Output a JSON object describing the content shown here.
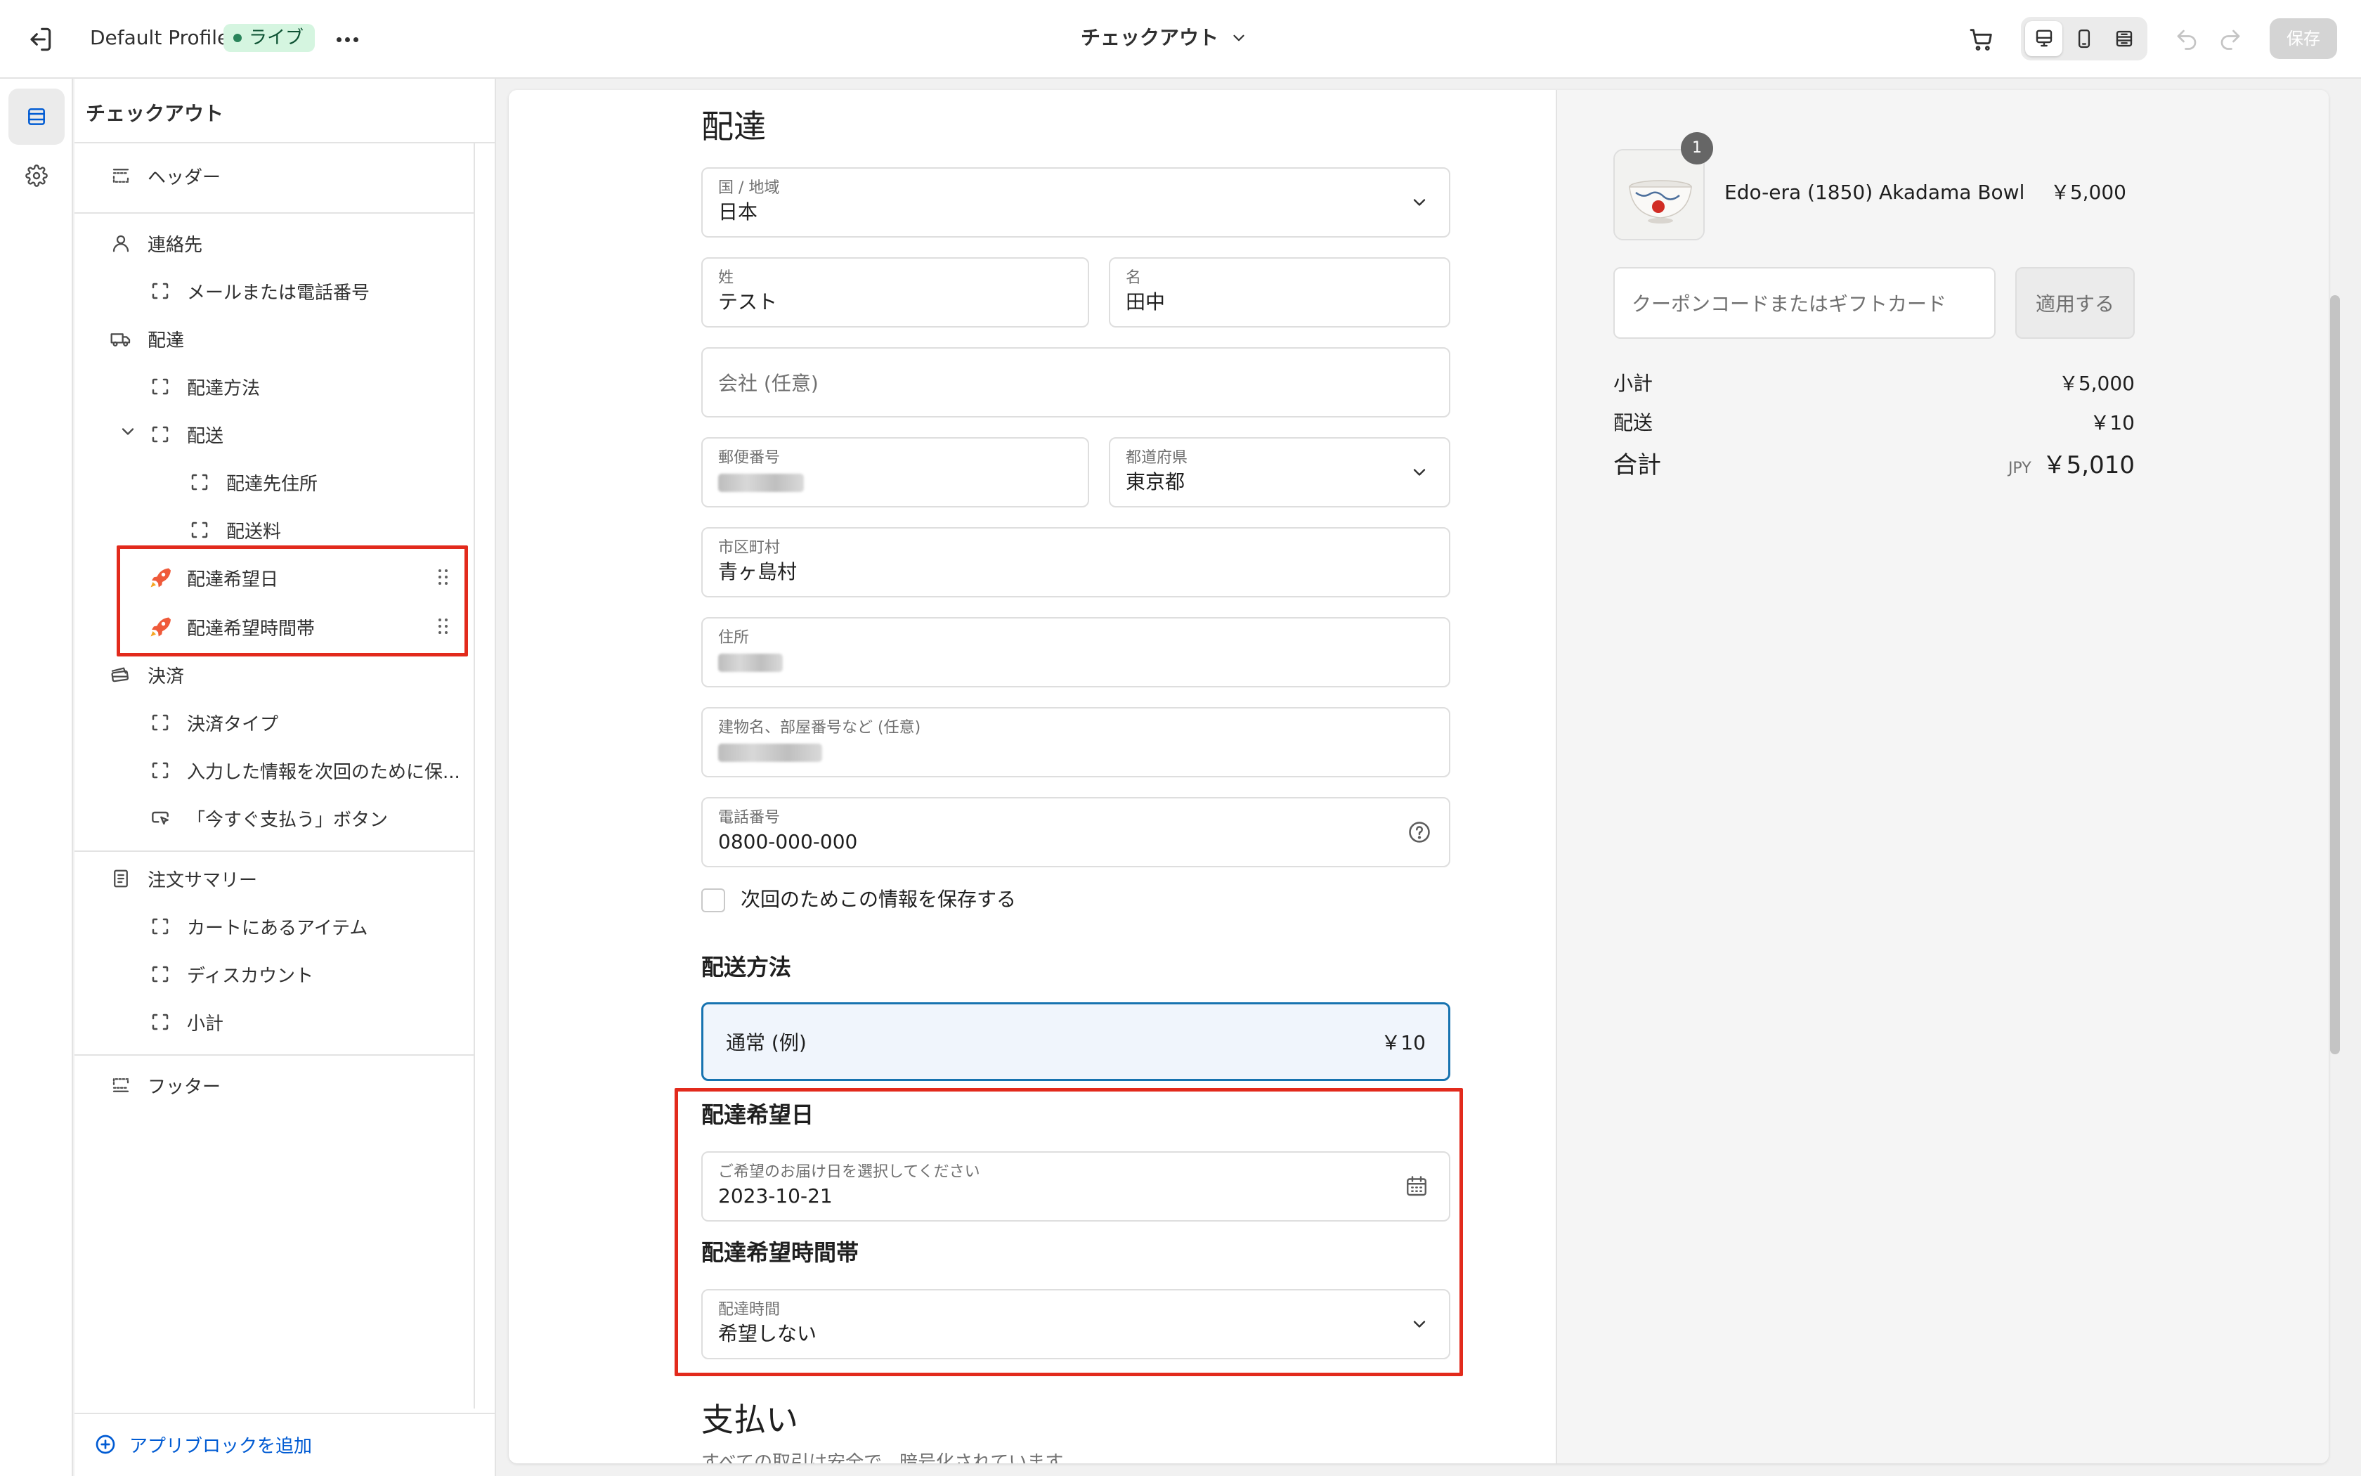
{
  "topbar": {
    "profile_name": "Default Profile",
    "status_badge": "ライブ",
    "page_selector": "チェックアウト",
    "save_label": "保存"
  },
  "sidebar": {
    "title": "チェックアウト",
    "items": {
      "header": "ヘッダー",
      "contact": "連絡先",
      "email_or_phone": "メールまたは電話番号",
      "delivery": "配達",
      "delivery_method": "配達方法",
      "shipping": "配送",
      "shipping_address": "配達先住所",
      "shipping_fee": "配送料",
      "delivery_date": "配達希望日",
      "delivery_time": "配達希望時間帯",
      "payment": "決済",
      "payment_type": "決済タイプ",
      "remember_me": "入力した情報を次回のために保...",
      "pay_now_button": "「今すぐ支払う」ボタン",
      "order_summary": "注文サマリー",
      "cart_items": "カートにあるアイテム",
      "discount": "ディスカウント",
      "subtotal": "小計",
      "footer": "フッター"
    },
    "add_app_block": "アプリブロックを追加"
  },
  "checkout": {
    "delivery_heading": "配達",
    "country_label": "国 / 地域",
    "country_value": "日本",
    "last_name_label": "姓",
    "last_name_value": "テスト",
    "first_name_label": "名",
    "first_name_value": "田中",
    "company_placeholder": "会社 (任意)",
    "postal_label": "郵便番号",
    "prefecture_label": "都道府県",
    "prefecture_value": "東京都",
    "city_label": "市区町村",
    "city_value": "青ヶ島村",
    "address_label": "住所",
    "building_label": "建物名、部屋番号など (任意)",
    "phone_label": "電話番号",
    "phone_value": "0800-000-000",
    "save_info_label": "次回のためこの情報を保存する",
    "shipping_method_heading": "配送方法",
    "shipping_option_name": "通常 (例)",
    "shipping_option_price": "￥10",
    "delivery_date_heading": "配達希望日",
    "delivery_date_label": "ご希望のお届け日を選択してください",
    "delivery_date_value": "2023-10-21",
    "delivery_time_heading": "配達希望時間帯",
    "delivery_time_label": "配達時間",
    "delivery_time_value": "希望しない",
    "payment_heading": "支払い",
    "payment_note": "すべての取引は安全で、暗号化されています"
  },
  "summary": {
    "quantity": "1",
    "product_name": "Edo-era (1850) Akadama Bowl",
    "product_price": "￥5,000",
    "coupon_placeholder": "クーポンコードまたはギフトカード",
    "apply_label": "適用する",
    "subtotal_label": "小計",
    "subtotal_value": "￥5,000",
    "shipping_label": "配送",
    "shipping_value": "￥10",
    "total_label": "合計",
    "currency": "JPY",
    "total_value": "￥5,010"
  },
  "icons": [
    "exit-icon",
    "more-icon",
    "chevron-down-icon",
    "cart-icon",
    "desktop-view-icon",
    "mobile-view-icon",
    "fullwidth-view-icon",
    "undo-icon",
    "redo-icon",
    "sections-icon",
    "settings-icon",
    "header-icon",
    "person-icon",
    "truck-icon",
    "block-icon",
    "app-rocket-icon",
    "drag-handle-icon",
    "payment-icon",
    "pay-button-icon",
    "receipt-icon",
    "footer-icon",
    "plus-circle-icon",
    "help-icon",
    "calendar-icon"
  ],
  "colors": {
    "highlight": "#e22a1c",
    "accent": "#1773b0",
    "live_badge_bg": "#d5f5e0",
    "link": "#005bd3"
  }
}
